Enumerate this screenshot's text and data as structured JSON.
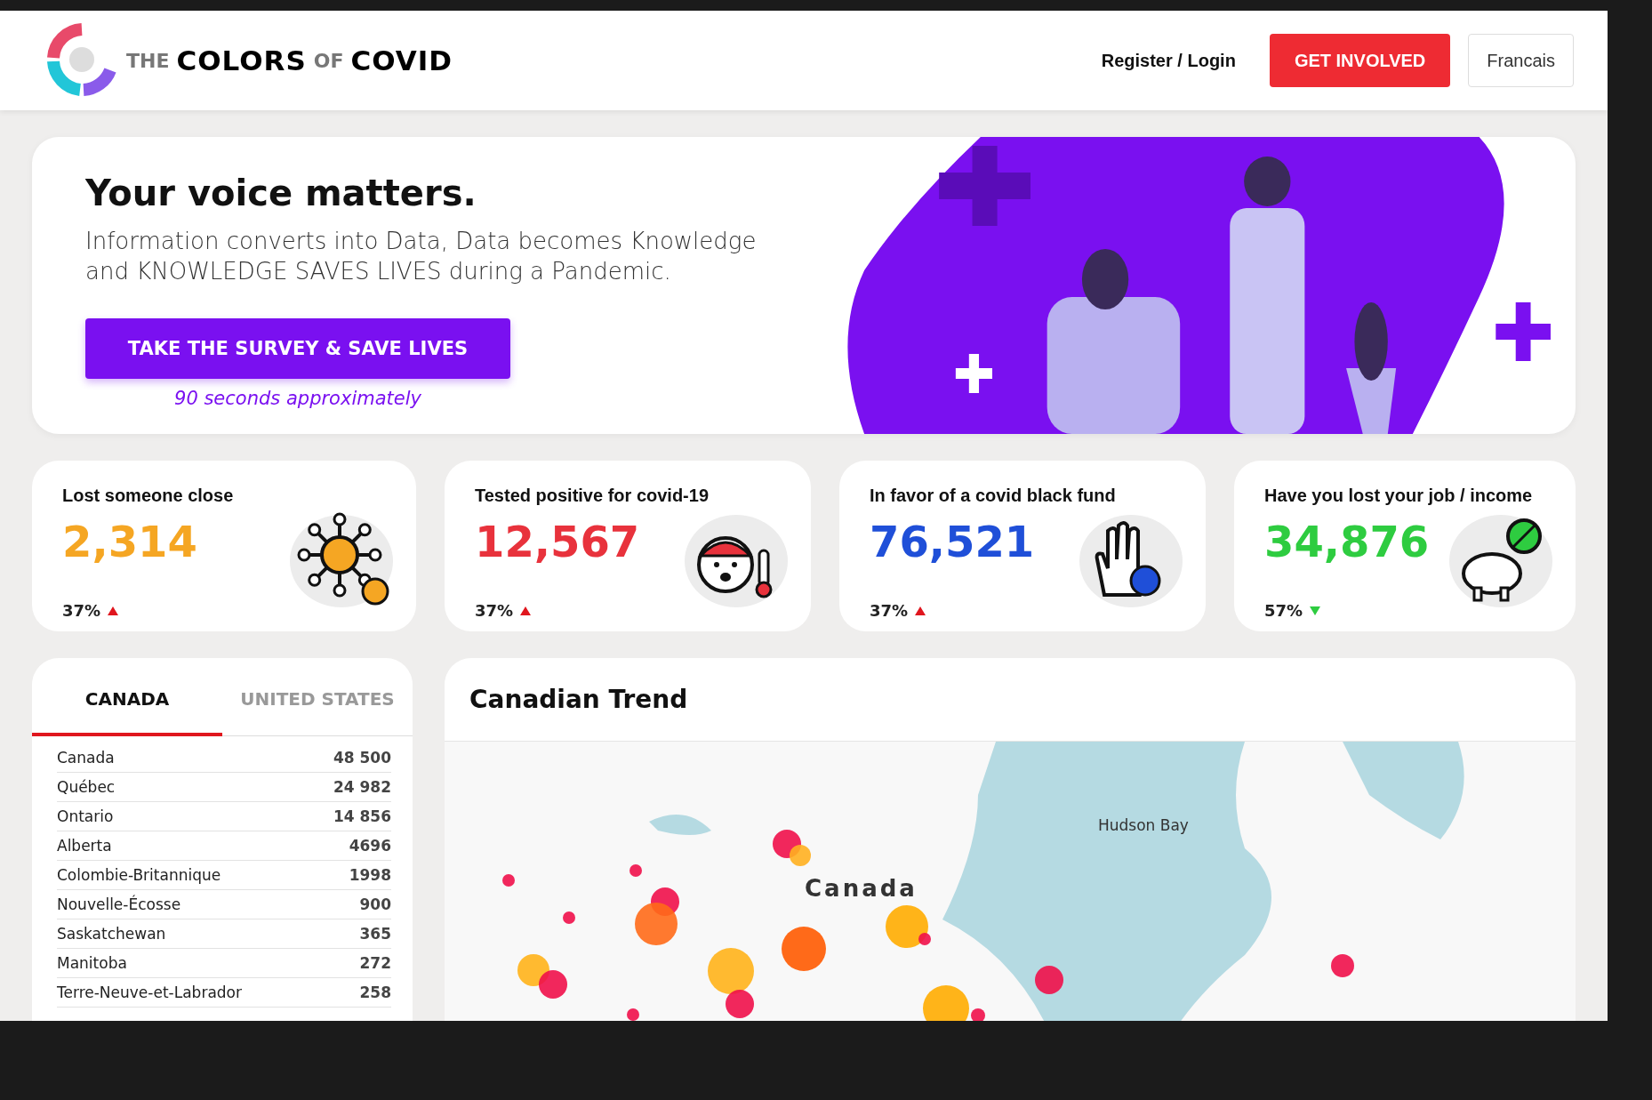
{
  "header": {
    "logo": [
      {
        "text": "THE",
        "kind": "minor"
      },
      {
        "text": "COLORS",
        "kind": "major"
      },
      {
        "text": "OF",
        "kind": "minor"
      },
      {
        "text": "COVID",
        "kind": "major"
      }
    ],
    "nav": [
      {
        "label": "Register / Login",
        "kind": "link"
      },
      {
        "label": "GET INVOLVED",
        "kind": "primary"
      },
      {
        "label": "Francais",
        "kind": "outline"
      }
    ]
  },
  "hero": {
    "title": "Your voice matters.",
    "text": "Information converts into Data, Data becomes Knowledge and KNOWLEDGE SAVES LIVES during a Pandemic.",
    "button": "TAKE THE SURVEY & SAVE LIVES",
    "note": "90 seconds approximately"
  },
  "stats": [
    {
      "title": "Lost someone close",
      "value": "2,314",
      "color": "#f5a623",
      "change": "37%",
      "rising": true
    },
    {
      "title": "Tested positive for covid-19",
      "value": "12,567",
      "color": "#e8323c",
      "change": "37%",
      "rising": true
    },
    {
      "title": "In favor of a covid black fund",
      "value": "76,521",
      "color": "#1f4fd8",
      "change": "37%",
      "rising": true
    },
    {
      "title": "Have you lost your job / income",
      "value": "34,876",
      "color": "#2ecc40",
      "change": "57%",
      "rising": false
    }
  ],
  "regions": {
    "tabs": [
      {
        "label": "CANADA",
        "selected": true
      },
      {
        "label": "UNITED STATES",
        "selected": false
      }
    ],
    "rows": [
      {
        "name": "Canada",
        "count": "48 500"
      },
      {
        "name": "Québec",
        "count": "24 982"
      },
      {
        "name": "Ontario",
        "count": "14 856"
      },
      {
        "name": "Alberta",
        "count": "4696"
      },
      {
        "name": "Colombie-Britannique",
        "count": "1998"
      },
      {
        "name": "Nouvelle-Écosse",
        "count": "900"
      },
      {
        "name": "Saskatchewan",
        "count": "365"
      },
      {
        "name": "Manitoba",
        "count": "272"
      },
      {
        "name": "Terre-Neuve-et-Labrador",
        "count": "258"
      }
    ]
  },
  "trend": {
    "title": "Canadian Trend",
    "map_labels": [
      {
        "text": "Hudson Bay",
        "kind": "water"
      },
      {
        "text": "Canada",
        "kind": "country"
      }
    ]
  }
}
